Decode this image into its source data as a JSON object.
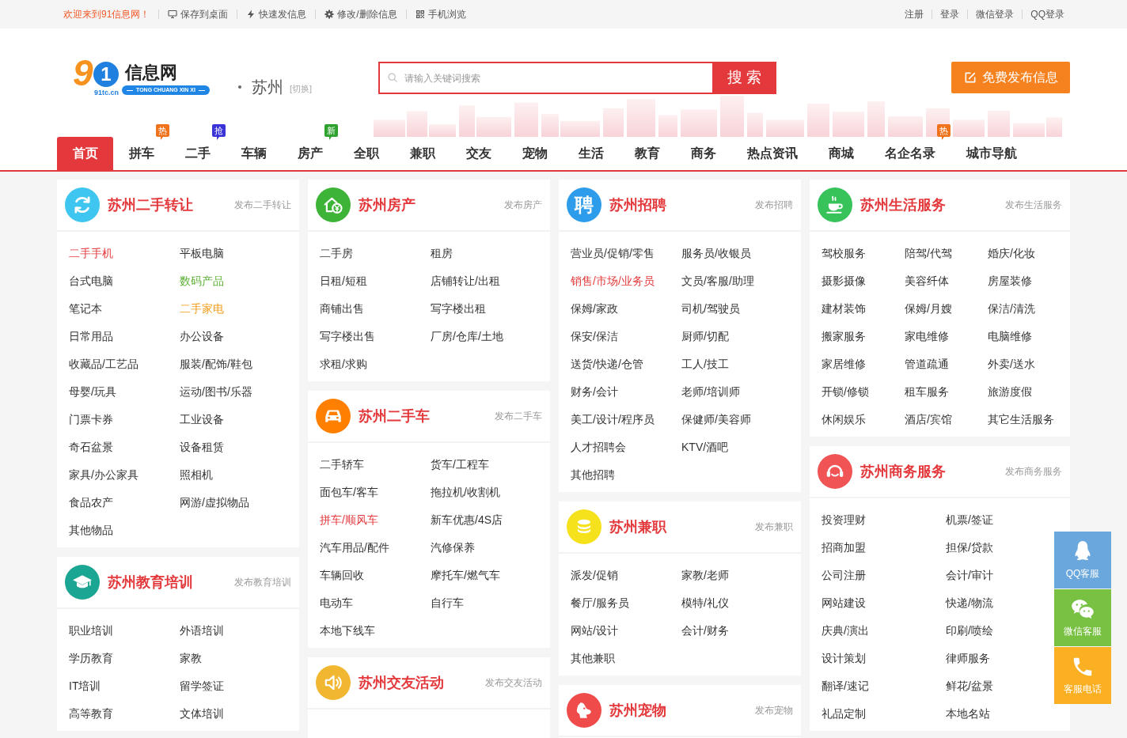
{
  "top_bar": {
    "welcome": "欢迎来到91信息网！",
    "links": [
      "保存到桌面",
      "快速发信息",
      "修改/删除信息",
      "手机浏览"
    ],
    "account_links": [
      "注册",
      "登录",
      "微信登录",
      "QQ登录"
    ]
  },
  "logo": {
    "mark": "91",
    "domain": "91tc.cn",
    "name": "信息网",
    "tagline": "TONG CHUANG XIN XI"
  },
  "city": {
    "name": "苏州",
    "switch": "[切换]"
  },
  "search": {
    "placeholder": "请输入关键词搜索",
    "button": "搜 索"
  },
  "publish_button": "免费发布信息",
  "nav": [
    {
      "label": "首页",
      "selected": true
    },
    {
      "label": "拼车",
      "selected": false,
      "badge": {
        "text": "热",
        "color": "#f0731c"
      }
    },
    {
      "label": "二手",
      "selected": false,
      "badge": {
        "text": "抢",
        "color": "#3a34d6"
      }
    },
    {
      "label": "车辆",
      "selected": false
    },
    {
      "label": "房产",
      "selected": false,
      "badge": {
        "text": "新",
        "color": "#2ea12e"
      }
    },
    {
      "label": "全职",
      "selected": false
    },
    {
      "label": "兼职",
      "selected": false
    },
    {
      "label": "交友",
      "selected": false
    },
    {
      "label": "宠物",
      "selected": false
    },
    {
      "label": "生活",
      "selected": false
    },
    {
      "label": "教育",
      "selected": false
    },
    {
      "label": "商务",
      "selected": false
    },
    {
      "label": "热点资讯",
      "selected": false
    },
    {
      "label": "商城",
      "selected": false
    },
    {
      "label": "名企名录",
      "selected": false,
      "badge": {
        "text": "热",
        "color": "#f0731c"
      }
    },
    {
      "label": "城市导航",
      "selected": false
    }
  ],
  "columns": [
    {
      "sections": [
        {
          "title": "苏州二手转让",
          "publish_link": "发布二手转让",
          "color": "#3fc6f0",
          "rows": [
            [
              {
                "label": "二手手机",
                "color": "#e4393c"
              },
              {
                "label": "平板电脑"
              }
            ],
            [
              {
                "label": "台式电脑"
              },
              {
                "label": "数码产品",
                "color": "#5bb035"
              }
            ],
            [
              {
                "label": "笔记本"
              },
              {
                "label": "二手家电",
                "color": "#f39c1a"
              }
            ],
            [
              {
                "label": "日常用品"
              },
              {
                "label": "办公设备"
              }
            ],
            [
              {
                "label": "收藏品/工艺品"
              },
              {
                "label": "服装/配饰/鞋包"
              }
            ],
            [
              {
                "label": "母婴/玩具"
              },
              {
                "label": "运动/图书/乐器"
              }
            ],
            [
              {
                "label": "门票卡券"
              },
              {
                "label": "工业设备"
              }
            ],
            [
              {
                "label": "奇石盆景"
              },
              {
                "label": "设备租赁"
              }
            ],
            [
              {
                "label": "家具/办公家具"
              },
              {
                "label": "照相机"
              }
            ],
            [
              {
                "label": "食品农产"
              },
              {
                "label": "网游/虚拟物品"
              }
            ],
            [
              {
                "label": "其他物品"
              }
            ]
          ]
        },
        {
          "title": "苏州教育培训",
          "publish_link": "发布教育培训",
          "color": "#1ba593",
          "rows": [
            [
              {
                "label": "职业培训"
              },
              {
                "label": "外语培训"
              }
            ],
            [
              {
                "label": "学历教育"
              },
              {
                "label": "家教"
              }
            ],
            [
              {
                "label": "IT培训"
              },
              {
                "label": "留学签证"
              }
            ],
            [
              {
                "label": "高等教育"
              },
              {
                "label": "文体培训"
              }
            ]
          ]
        }
      ]
    },
    {
      "sections": [
        {
          "title": "苏州房产",
          "publish_link": "发布房产",
          "color": "#3db337",
          "rows": [
            [
              {
                "label": "二手房"
              },
              {
                "label": "租房"
              }
            ],
            [
              {
                "label": "日租/短租"
              },
              {
                "label": "店铺转让/出租"
              }
            ],
            [
              {
                "label": "商铺出售"
              },
              {
                "label": "写字楼出租"
              }
            ],
            [
              {
                "label": "写字楼出售"
              },
              {
                "label": "厂房/仓库/土地"
              }
            ],
            [
              {
                "label": "求租/求购"
              }
            ]
          ]
        },
        {
          "title": "苏州二手车",
          "publish_link": "发布二手车",
          "color": "#ff8000",
          "rows": [
            [
              {
                "label": "二手轿车"
              },
              {
                "label": "货车/工程车"
              }
            ],
            [
              {
                "label": "面包车/客车"
              },
              {
                "label": "拖拉机/收割机"
              }
            ],
            [
              {
                "label": "拼车/顺风车",
                "color": "#e4393c"
              },
              {
                "label": "新车优惠/4S店"
              }
            ],
            [
              {
                "label": "汽车用品/配件"
              },
              {
                "label": "汽修保养"
              }
            ],
            [
              {
                "label": "车辆回收"
              },
              {
                "label": "摩托车/燃气车"
              }
            ],
            [
              {
                "label": "电动车"
              },
              {
                "label": "自行车"
              }
            ],
            [
              {
                "label": "本地下线车"
              }
            ]
          ]
        },
        {
          "title": "苏州交友活动",
          "publish_link": "发布交友活动",
          "color": "#f2b731"
        }
      ]
    },
    {
      "sections": [
        {
          "title": "苏州招聘",
          "publish_link": "发布招聘",
          "color": "#2d9cea",
          "icon_text": "聘",
          "rows": [
            [
              {
                "label": "营业员/促销/零售"
              },
              {
                "label": "服务员/收银员"
              }
            ],
            [
              {
                "label": "销售/市场/业务员",
                "color": "#e4393c"
              },
              {
                "label": "文员/客服/助理"
              }
            ],
            [
              {
                "label": "保姆/家政"
              },
              {
                "label": "司机/驾驶员"
              }
            ],
            [
              {
                "label": "保安/保洁"
              },
              {
                "label": "厨师/切配"
              }
            ],
            [
              {
                "label": "送货/快递/仓管"
              },
              {
                "label": "工人/技工"
              }
            ],
            [
              {
                "label": "财务/会计"
              },
              {
                "label": "老师/培训师"
              }
            ],
            [
              {
                "label": "美工/设计/程序员"
              },
              {
                "label": "保健师/美容师"
              }
            ],
            [
              {
                "label": "人才招聘会"
              },
              {
                "label": "KTV/酒吧"
              }
            ],
            [
              {
                "label": "其他招聘"
              }
            ]
          ]
        },
        {
          "title": "苏州兼职",
          "publish_link": "发布兼职",
          "color": "#f5e21c",
          "rows": [
            [
              {
                "label": "派发/促销"
              },
              {
                "label": "家教/老师"
              }
            ],
            [
              {
                "label": "餐厅/服务员"
              },
              {
                "label": "模特/礼仪"
              }
            ],
            [
              {
                "label": "网站/设计"
              },
              {
                "label": "会计/财务"
              }
            ],
            [
              {
                "label": "其他兼职"
              }
            ]
          ]
        },
        {
          "title": "苏州宠物",
          "publish_link": "发布宠物",
          "color": "#ef4b4b"
        }
      ]
    },
    {
      "sections": [
        {
          "title": "苏州生活服务",
          "publish_link": "发布生活服务",
          "color": "#37c25a",
          "rows": [
            [
              {
                "label": "驾校服务"
              },
              {
                "label": "陪驾/代驾"
              },
              {
                "label": "婚庆/化妆"
              }
            ],
            [
              {
                "label": "摄影摄像"
              },
              {
                "label": "美容纤体"
              },
              {
                "label": "房屋装修"
              }
            ],
            [
              {
                "label": "建材装饰"
              },
              {
                "label": "保姆/月嫂"
              },
              {
                "label": "保洁/清洗"
              }
            ],
            [
              {
                "label": "搬家服务"
              },
              {
                "label": "家电维修"
              },
              {
                "label": "电脑维修"
              }
            ],
            [
              {
                "label": "家居维修"
              },
              {
                "label": "管道疏通"
              },
              {
                "label": "外卖/送水"
              }
            ],
            [
              {
                "label": "开锁/修锁"
              },
              {
                "label": "租车服务"
              },
              {
                "label": "旅游度假"
              }
            ],
            [
              {
                "label": "休闲娱乐"
              },
              {
                "label": "酒店/宾馆"
              },
              {
                "label": "其它生活服务"
              }
            ]
          ]
        },
        {
          "title": "苏州商务服务",
          "publish_link": "发布商务服务",
          "color": "#f05454",
          "rows": [
            [
              {
                "label": "投资理财"
              },
              {
                "label": "机票/签证"
              }
            ],
            [
              {
                "label": "招商加盟"
              },
              {
                "label": "担保/贷款"
              }
            ],
            [
              {
                "label": "公司注册"
              },
              {
                "label": "会计/审计"
              }
            ],
            [
              {
                "label": "网站建设"
              },
              {
                "label": "快递/物流"
              }
            ],
            [
              {
                "label": "庆典/演出"
              },
              {
                "label": "印刷/喷绘"
              }
            ],
            [
              {
                "label": "设计策划"
              },
              {
                "label": "律师服务"
              }
            ],
            [
              {
                "label": "翻译/速记"
              },
              {
                "label": "鲜花/盆景"
              }
            ],
            [
              {
                "label": "礼品定制"
              },
              {
                "label": "本地名站"
              }
            ]
          ]
        }
      ]
    }
  ],
  "side_buttons": [
    {
      "label": "QQ客服",
      "color": "#6aa7dc"
    },
    {
      "label": "微信客服",
      "color": "#79c143"
    },
    {
      "label": "客服电话",
      "color": "#fbb023"
    }
  ]
}
